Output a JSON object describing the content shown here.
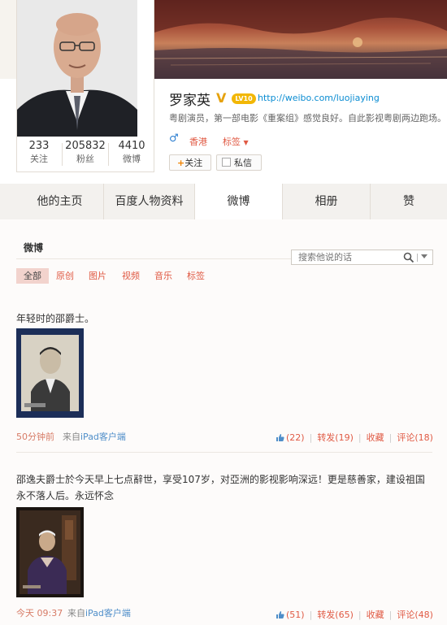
{
  "profile": {
    "name": "罗家英",
    "level_badge": "LV10",
    "homepage": "http://weibo.com/luojiaying",
    "bio": "粤剧演员，第一部电影《重案组》感觉良好。自此影视粤剧两边跑场。",
    "location": "香港",
    "tags_label": "标签",
    "follow_label": "关注",
    "message_label": "私信",
    "stats": [
      {
        "value": "233",
        "label": "关注"
      },
      {
        "value": "205832",
        "label": "粉丝"
      },
      {
        "value": "4410",
        "label": "微博"
      }
    ]
  },
  "tabs": [
    {
      "label": "他的主页"
    },
    {
      "label": "百度人物资料"
    },
    {
      "label": "微博"
    },
    {
      "label": "相册"
    },
    {
      "label": "赞"
    }
  ],
  "feed": {
    "title": "微博",
    "search_placeholder": "搜索他说的话",
    "filters": [
      "全部",
      "原创",
      "图片",
      "视频",
      "音乐",
      "标签"
    ]
  },
  "posts": [
    {
      "text": "年轻时的邵爵士。",
      "time": "50分钟前",
      "source_prefix": "来自",
      "source_app": "iPad客户端",
      "likes": "(22)",
      "repost": "转发(19)",
      "favorite": "收藏",
      "comment": "评论(18)"
    },
    {
      "text": "邵逸夫爵士於今天早上七点辭世，享受107岁，对亞洲的影视影响深远！更是慈善家，建设祖国永不落人后。永远怀念",
      "time": "今天 09:37",
      "source_prefix": "来自",
      "source_app": "iPad客户端",
      "likes": "(51)",
      "repost": "转发(65)",
      "favorite": "收藏",
      "comment": "评论(48)"
    }
  ],
  "colors": {
    "accent": "#e05a44",
    "link_blue": "#0a8cd2",
    "tab_bg": "#f3f1ee",
    "verified_gold": "#f2b705"
  }
}
